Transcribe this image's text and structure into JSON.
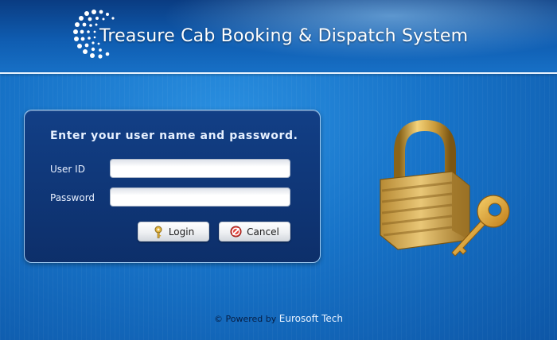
{
  "header": {
    "title": "Treasure Cab Booking & Dispatch System",
    "logo_icon": "dotted-circle-logo-icon"
  },
  "login_panel": {
    "heading": "Enter your user name and password.",
    "user_id_label": "User ID",
    "user_id_value": "",
    "password_label": "Password",
    "password_value": "",
    "login_button": {
      "label": "Login",
      "icon": "key-icon"
    },
    "cancel_button": {
      "label": "Cancel",
      "icon": "cancel-icon"
    }
  },
  "illustration": {
    "icon": "padlock-with-key-icon"
  },
  "footer": {
    "prefix": "© Powered by",
    "brand": "Eurosoft Tech"
  },
  "colors": {
    "background": "#1773c8",
    "header": "#0f5cb0",
    "panel": "#0d2f6a",
    "panel_border": "#9cc8f0",
    "lock_gold": "#c9a24a"
  }
}
